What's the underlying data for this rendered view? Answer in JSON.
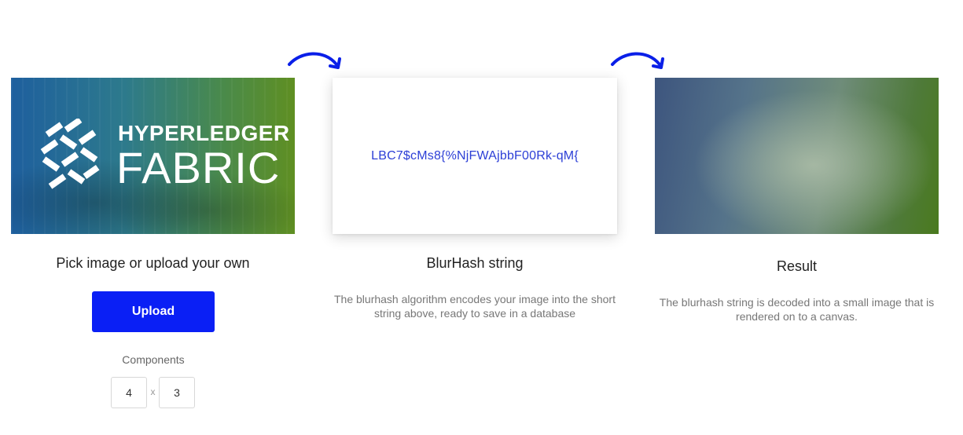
{
  "colors": {
    "accent": "#0a1ff5",
    "hash_text": "#2c3fd6",
    "arrow": "#0a1fe8"
  },
  "source_panel": {
    "image_logo": "HYPERLEDGER FABRIC",
    "title": "Pick image or upload your own",
    "upload_label": "Upload",
    "components_label": "Components",
    "components_x": "4",
    "components_times": "x",
    "components_y": "3"
  },
  "hash_panel": {
    "hash": "LBC7$cMs8{%NjFWAjbbF00Rk-qM{",
    "title": "BlurHash string",
    "description": "The blurhash algorithm encodes your image into the short string above, ready to save in a database"
  },
  "result_panel": {
    "title": "Result",
    "description": "The blurhash string is decoded into a small image that is rendered on to a canvas."
  },
  "icons": [
    "curved-arrow-icon",
    "curved-arrow-icon",
    "hyperledger-logo-icon"
  ]
}
